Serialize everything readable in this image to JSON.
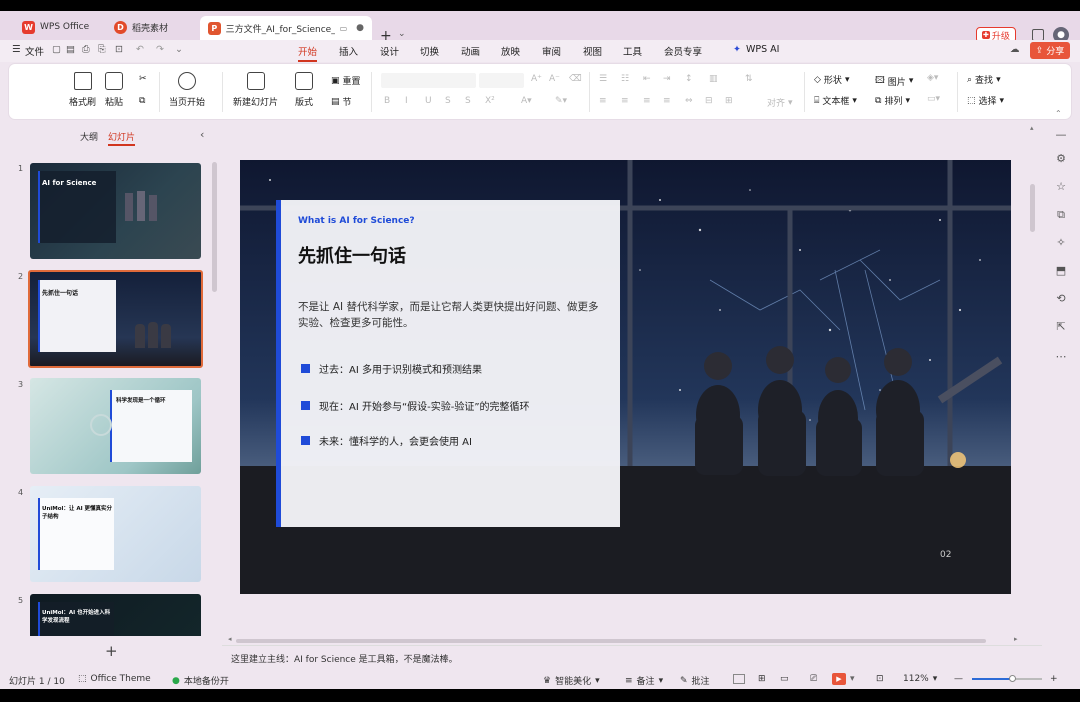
{
  "tabs": [
    {
      "label": "WPS Office"
    },
    {
      "label": "稻壳素材"
    },
    {
      "label": "三方文件_AI_for_Science_l"
    }
  ],
  "upgrade_label": "升级",
  "share_label": "分享",
  "file_menu": "文件",
  "menu": [
    "开始",
    "插入",
    "设计",
    "切换",
    "动画",
    "放映",
    "审阅",
    "视图",
    "工具",
    "会员专享"
  ],
  "wps_ai": "WPS AI",
  "ribbon": {
    "format_painter": "格式刷",
    "paste": "粘贴",
    "from_current": "当页开始",
    "new_slide": "新建幻灯片",
    "layout": "版式",
    "section": "节",
    "reset": "重置",
    "shapes": "形状",
    "picture": "图片",
    "textbox": "文本框",
    "arrange": "排列",
    "find": "查找",
    "select": "选择",
    "align": "对齐"
  },
  "left_tabs": {
    "outline": "大纲",
    "slides": "幻灯片"
  },
  "thumbs": [
    {
      "num": "1",
      "title": "AI for Science"
    },
    {
      "num": "2",
      "title": "先抓住一句话"
    },
    {
      "num": "3",
      "title": "科学发现是一个循环"
    },
    {
      "num": "4",
      "title": "UniMol：让 AI 更懂真实分子结构"
    },
    {
      "num": "5",
      "title": "UniMol：AI 也开始进入科学发现流程"
    }
  ],
  "slide": {
    "kicker": "What is AI for Science?",
    "title": "先抓住一句话",
    "intro": "不是让 AI 替代科学家，而是让它帮人类更快提出好问题、做更多实验、检查更多可能性。",
    "bullets": [
      "过去：AI 多用于识别模式和预测结果",
      "现在：AI 开始参与“假设-实验-验证”的完整循环",
      "未来：懂科学的人，会更会使用 AI"
    ],
    "page_num": "02"
  },
  "notes": "这里建立主线：AI for Science 是工具箱，不是魔法棒。",
  "status": {
    "slide_count": "幻灯片 1 / 10",
    "theme": "Office Theme",
    "backup": "本地备份开",
    "beautify": "智能美化",
    "notes_btn": "备注",
    "comment_btn": "批注",
    "zoom": "112%"
  },
  "colors": {
    "accent": "#d1361f",
    "brand_blue": "#1f4bd8",
    "wps_red": "#e63b2e"
  }
}
